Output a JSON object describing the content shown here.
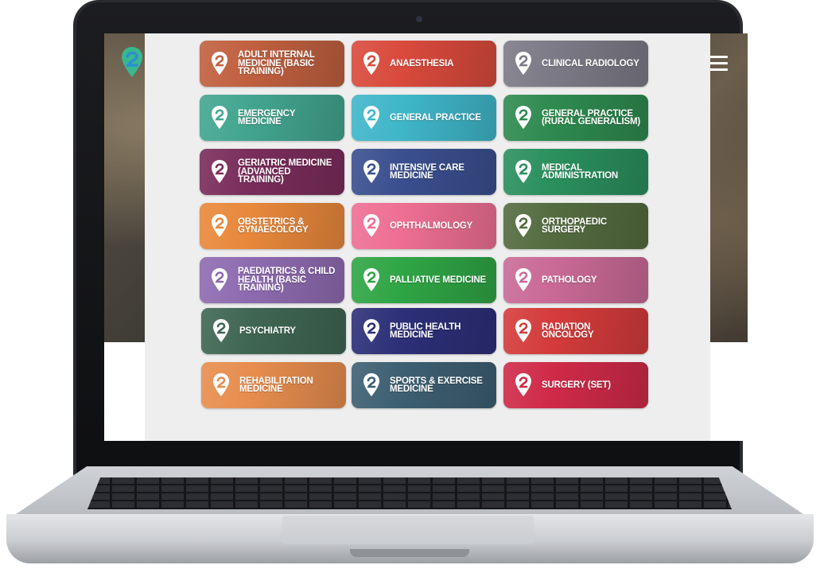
{
  "site": {
    "logo_icon": "pin-logo-icon",
    "menu_icon": "hamburger-menu-icon"
  },
  "tiles": [
    {
      "label": "Adult Internal Medicine (Basic Training)",
      "color": "#c0603f"
    },
    {
      "label": "Anaesthesia",
      "color": "#d94a3c"
    },
    {
      "label": "Clinical Radiology",
      "color": "#7c7a86"
    },
    {
      "label": "Emergency Medicine",
      "color": "#42a58f"
    },
    {
      "label": "General Practice",
      "color": "#3fb6c9"
    },
    {
      "label": "General Practice (Rural Generalism)",
      "color": "#2e8a4f"
    },
    {
      "label": "Geriatric Medicine (Advanced Training)",
      "color": "#7a2d5b"
    },
    {
      "label": "Intensive Care Medicine",
      "color": "#3a4f8f"
    },
    {
      "label": "Medical Administration",
      "color": "#2a8f5d"
    },
    {
      "label": "Obstetrics & Gynaecology",
      "color": "#e8883b"
    },
    {
      "label": "Ophthalmology",
      "color": "#ee6f93"
    },
    {
      "label": "Orthopaedic Surgery",
      "color": "#546b3f"
    },
    {
      "label": "Paediatrics & Child Health (Basic Training)",
      "color": "#8e6bb0"
    },
    {
      "label": "Palliative Medicine",
      "color": "#2fa545"
    },
    {
      "label": "Pathology",
      "color": "#c96a96"
    },
    {
      "label": "Psychiatry",
      "color": "#3f6653"
    },
    {
      "label": "Public Health Medicine",
      "color": "#2d2f78"
    },
    {
      "label": "Radiation Oncology",
      "color": "#d43b3b"
    },
    {
      "label": "Rehabilitation Medicine",
      "color": "#e78d4e"
    },
    {
      "label": "Sports & Exercise Medicine",
      "color": "#3d5f72"
    },
    {
      "label": "Surgery (SET)",
      "color": "#cf2a48"
    }
  ],
  "tile_icon": "pin-logo-icon"
}
